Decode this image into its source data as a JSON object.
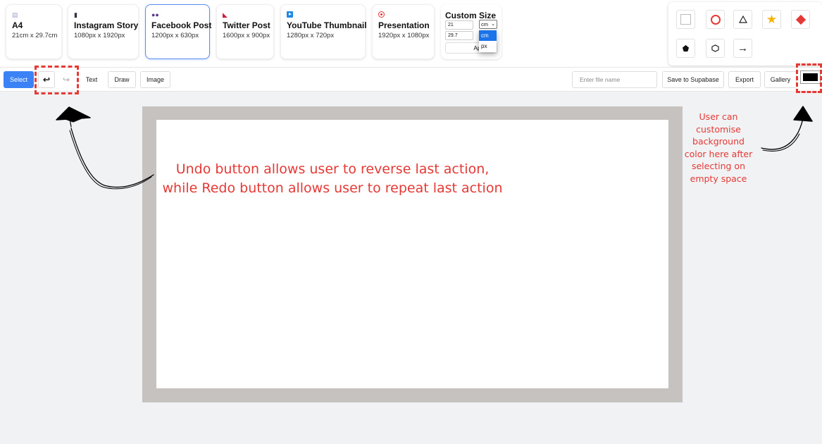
{
  "presets": [
    {
      "icon": "📄",
      "icon_name": "document-icon",
      "name": "A4",
      "size": "21cm x 29.7cm"
    },
    {
      "icon": "📱",
      "icon_name": "phone-icon",
      "name": "Instagram Story",
      "size": "1080px x 1920px"
    },
    {
      "icon": "👥",
      "icon_name": "people-icon",
      "name": "Facebook Post",
      "size": "1200px x 630px",
      "selected": true
    },
    {
      "icon": "🐦",
      "icon_name": "bird-icon",
      "name": "Twitter Post",
      "size": "1600px x 900px"
    },
    {
      "icon": "▶",
      "icon_name": "play-icon",
      "name": "YouTube Thumbnail",
      "size": "1280px x 720px"
    },
    {
      "icon": "🎯",
      "icon_name": "target-icon",
      "name": "Presentation",
      "size": "1920px x 1080px"
    }
  ],
  "custom_size": {
    "title": "Custom Size",
    "width_value": "21",
    "height_value": "29.7",
    "unit_selected": "cm",
    "unit_options": [
      "cm",
      "px"
    ],
    "apply_label": "Apply"
  },
  "shapes": [
    {
      "name": "square-icon"
    },
    {
      "name": "circle-icon"
    },
    {
      "name": "triangle-icon"
    },
    {
      "name": "star-icon"
    },
    {
      "name": "diamond-icon"
    },
    {
      "name": "pentagon-icon"
    },
    {
      "name": "hexagon-icon"
    },
    {
      "name": "arrow-right-icon"
    }
  ],
  "toolbar": {
    "select_label": "Select",
    "undo_icon": "undo-icon",
    "redo_icon": "redo-icon",
    "text_label": "Text",
    "draw_label": "Draw",
    "image_label": "Image",
    "filename_placeholder": "Enter file name",
    "save_label": "Save to Supabase",
    "export_label": "Export",
    "gallery_label": "Gallery",
    "bg_color": "#000000"
  },
  "annotations": {
    "main_line1": "Undo button allows user to reverse last action,",
    "main_line2": "while Redo button allows user to repeat last action",
    "side_text": "User can customise background color here after selecting on empty space"
  },
  "colors": {
    "accent": "#3b82f6",
    "annotation": "#e53935",
    "canvas_border": "#c6c2c0"
  }
}
